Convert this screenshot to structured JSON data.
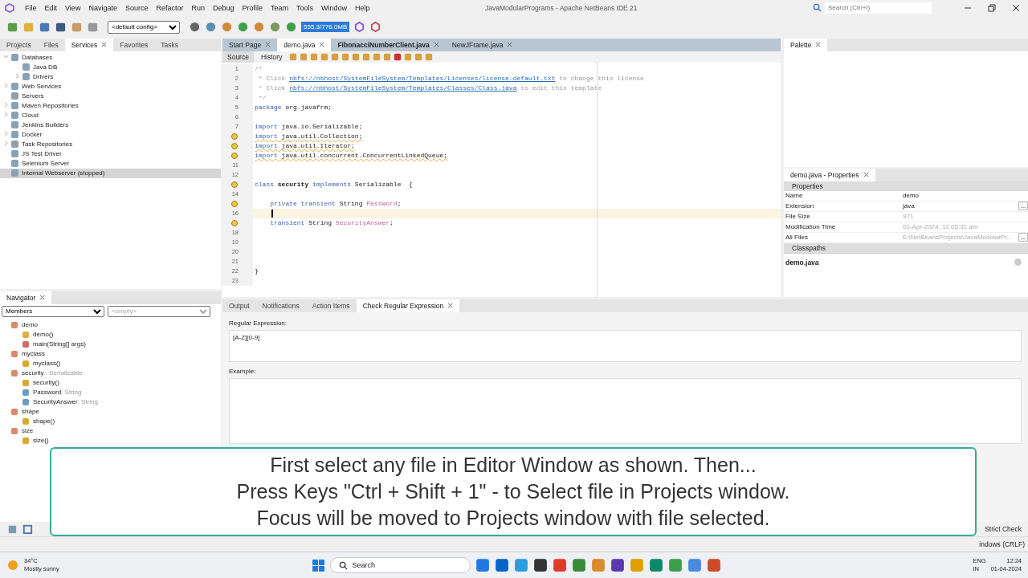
{
  "window": {
    "title": "JavaModularPrograms - Apache NetBeans IDE 21",
    "search_placeholder": "Search (Ctrl+I)"
  },
  "menu": [
    "File",
    "Edit",
    "View",
    "Navigate",
    "Source",
    "Refactor",
    "Run",
    "Debug",
    "Profile",
    "Team",
    "Tools",
    "Window",
    "Help"
  ],
  "toolbar": {
    "config": "<default config>",
    "memory": "555.3/776.0MB"
  },
  "left_tabs": [
    {
      "label": "Projects",
      "selected": false
    },
    {
      "label": "Files",
      "selected": false
    },
    {
      "label": "Services",
      "selected": true
    },
    {
      "label": "Favorites",
      "selected": false
    },
    {
      "label": "Tasks",
      "selected": false
    }
  ],
  "services": [
    {
      "label": "Databases",
      "expanded": true,
      "selected": false,
      "children": [
        {
          "label": "Java DB",
          "selected": false
        },
        {
          "label": "Drivers",
          "expanded": false,
          "selected": false
        }
      ]
    },
    {
      "label": "Web Services",
      "expanded": false,
      "selected": false
    },
    {
      "label": "Servers",
      "selected": false
    },
    {
      "label": "Maven Repositories",
      "expanded": false,
      "selected": false
    },
    {
      "label": "Cloud",
      "expanded": false,
      "selected": false
    },
    {
      "label": "Jenkins Builders",
      "selected": false
    },
    {
      "label": "Docker",
      "expanded": false,
      "selected": false
    },
    {
      "label": "Task Repositories",
      "expanded": false,
      "selected": false
    },
    {
      "label": "JS Test Driver",
      "selected": false
    },
    {
      "label": "Selenium Server",
      "selected": false
    },
    {
      "label": "Internal Webserver (stopped)",
      "selected": true
    }
  ],
  "navigator": {
    "title": "Navigator",
    "filter": "Members",
    "second_filter": "<empty>",
    "items": [
      {
        "label": "demo",
        "kind": "class",
        "children": [
          {
            "label": "demo()",
            "kind": "constructor"
          },
          {
            "label": "main(String[] args)",
            "kind": "static"
          }
        ]
      },
      {
        "label": "myclass",
        "kind": "class",
        "children": [
          {
            "label": "myclass()",
            "kind": "method"
          }
        ]
      },
      {
        "label": "security",
        "detail": ":: Serializable",
        "kind": "class",
        "children": [
          {
            "label": "security()",
            "kind": "method"
          },
          {
            "label": "Password",
            "detail": ": String",
            "kind": "field"
          },
          {
            "label": "SecurityAnswer",
            "detail": ": String",
            "kind": "field"
          }
        ]
      },
      {
        "label": "shape",
        "kind": "class",
        "children": [
          {
            "label": "shape()",
            "kind": "method"
          }
        ]
      },
      {
        "label": "size",
        "kind": "class",
        "children": [
          {
            "label": "size()",
            "kind": "method"
          }
        ]
      }
    ]
  },
  "editor_tabs": [
    {
      "label": "Start Page",
      "selected": false,
      "bold": false
    },
    {
      "label": "demo.java",
      "selected": true,
      "bold": false
    },
    {
      "label": "FibonacciNumberClient.java",
      "selected": false,
      "bold": true
    },
    {
      "label": "NewJFrame.java",
      "selected": false,
      "bold": false
    }
  ],
  "editor_modes": [
    {
      "label": "Source",
      "selected": true
    },
    {
      "label": "History",
      "selected": false
    }
  ],
  "code": [
    {
      "num": "1",
      "segments": [
        {
          "text": "/*",
          "kind": "comment"
        }
      ]
    },
    {
      "num": "2",
      "segments": [
        {
          "text": " * Click ",
          "kind": "comment"
        },
        {
          "text": "nbfs://nbhost/SystemFileSystem/Templates/Licenses/license-default.txt",
          "kind": "link"
        },
        {
          "text": " to change this license",
          "kind": "comment"
        }
      ]
    },
    {
      "num": "3",
      "segments": [
        {
          "text": " * Click ",
          "kind": "comment"
        },
        {
          "text": "nbfs://nbhost/SystemFileSystem/Templates/Classes/Class.java",
          "kind": "link"
        },
        {
          "text": " to edit this template",
          "kind": "comment"
        }
      ]
    },
    {
      "num": "4",
      "segments": [
        {
          "text": " */",
          "kind": "comment"
        }
      ]
    },
    {
      "num": "5",
      "segments": [
        {
          "text": "package",
          "kind": "keyword"
        },
        {
          "text": " org.javafrm;",
          "kind": "plain"
        }
      ]
    },
    {
      "num": "6"
    },
    {
      "num": "7",
      "segments": [
        {
          "text": "import",
          "kind": "keyword"
        },
        {
          "text": " java.io.Serializable;",
          "kind": "plain"
        }
      ]
    },
    {
      "hint": true,
      "warning": true,
      "segments": [
        {
          "text": "import",
          "kind": "keyword"
        },
        {
          "text": " java.util.Collection;",
          "kind": "plain"
        }
      ]
    },
    {
      "hint": true,
      "warning": true,
      "segments": [
        {
          "text": "import",
          "kind": "keyword"
        },
        {
          "text": " java.util.Iterator;",
          "kind": "plain"
        }
      ]
    },
    {
      "hint": true,
      "warning": true,
      "segments": [
        {
          "text": "import",
          "kind": "keyword"
        },
        {
          "text": " java.util.concurrent.ConcurrentLinkedQueue;",
          "kind": "plain"
        }
      ]
    },
    {
      "num": "11"
    },
    {
      "num": "12"
    },
    {
      "hint": true,
      "segments": [
        {
          "text": "class",
          "kind": "keyword"
        },
        {
          "text": " security",
          "kind": "bold"
        },
        {
          "text": " implements",
          "kind": "keyword"
        },
        {
          "text": " Serializable  {",
          "kind": "plain"
        }
      ]
    },
    {
      "num": "14"
    },
    {
      "hint": true,
      "segments": [
        {
          "text": "    private",
          "kind": "keyword"
        },
        {
          "text": " transient",
          "kind": "keyword"
        },
        {
          "text": " String ",
          "kind": "plain"
        },
        {
          "text": "Password",
          "kind": "field"
        },
        {
          "text": ";",
          "kind": "plain"
        }
      ]
    },
    {
      "num": "16",
      "current": true
    },
    {
      "hint": true,
      "segments": [
        {
          "text": "    transient",
          "kind": "keyword"
        },
        {
          "text": " String ",
          "kind": "plain"
        },
        {
          "text": "SecurityAnswer",
          "kind": "field"
        },
        {
          "text": ";",
          "kind": "plain"
        }
      ]
    },
    {
      "num": "18"
    },
    {
      "num": "19"
    },
    {
      "num": "20"
    },
    {
      "num": "21"
    },
    {
      "num": "22",
      "segments": [
        {
          "text": "}",
          "kind": "plain"
        }
      ]
    },
    {
      "num": "23"
    }
  ],
  "palette": {
    "title": "Palette"
  },
  "properties": {
    "title": "demo.java - Properties",
    "sections": [
      {
        "title": "Properties",
        "rows": [
          {
            "name": "Name",
            "value": "demo",
            "disabled": false
          },
          {
            "name": "Extension",
            "value": "java",
            "disabled": false,
            "button": "..."
          },
          {
            "name": "File Size",
            "value": "971",
            "disabled": true
          },
          {
            "name": "Modification Time",
            "value": "01-Apr-2024, 12:05:31 am",
            "disabled": true
          },
          {
            "name": "All Files",
            "value": "E:\\NetBeansProjects\\JavaModularPr...",
            "disabled": true,
            "button": "..."
          }
        ]
      },
      {
        "title": "Classpaths"
      }
    ],
    "footer": "demo.java"
  },
  "bottom_tabs": [
    {
      "label": "Output",
      "selected": false
    },
    {
      "label": "Notifications",
      "selected": false
    },
    {
      "label": "Action Items",
      "selected": false
    },
    {
      "label": "Check Regular Expression",
      "selected": true
    }
  ],
  "regex": {
    "label": "Regular Expression:",
    "value": "[A-Z][0-9]",
    "example_label": "Example:"
  },
  "bottom_strip": {
    "strict_check": "Strict Check"
  },
  "status_bar": {
    "line_endings": "indows (CRLF)"
  },
  "caption": [
    "First select any file in Editor Window as shown. Then...",
    "Press Keys \"Ctrl + Shift + 1\" - to Select file in Projects window.",
    "Focus will be moved to Projects window with file selected."
  ],
  "taskbar": {
    "temperature": "34°C",
    "weather": "Mostly sunny",
    "search": "Search",
    "language": "ENG",
    "region": "IN",
    "time": "12:24",
    "date": "01-04-2024"
  }
}
